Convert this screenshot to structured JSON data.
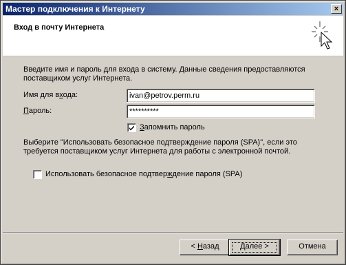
{
  "window": {
    "title": "Мастер подключения к Интернету",
    "close_glyph": "×"
  },
  "header": {
    "title": "Вход в почту Интернета",
    "icon": "wizard-wand-icon"
  },
  "main": {
    "intro": "Введите имя и пароль для входа в систему. Данные сведения предоставляются поставщиком услуг Интернета.",
    "username_label": "Имя для входа:",
    "username_value": "ivan@petrov.perm.ru",
    "password_label": "Пароль:",
    "password_value": "**********",
    "remember_label": "Запомнить пароль",
    "remember_checked": true,
    "spa_note": "Выберите \"Использовать безопасное подтверждение пароля (SPA)\", если это требуется поставщиком услуг Интернета для работы с электронной почтой.",
    "spa_label": "Использовать безопасное подтверждение пароля (SPA)",
    "spa_checked": false
  },
  "buttons": {
    "back": "< Назад",
    "next": "Далее >",
    "cancel": "Отмена"
  }
}
